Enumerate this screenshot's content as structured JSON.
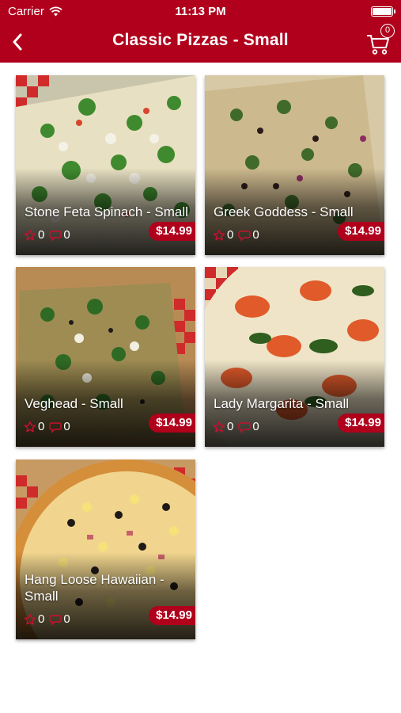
{
  "status_bar": {
    "carrier": "Carrier",
    "time": "11:13 PM",
    "icons": [
      "wifi-icon",
      "battery-icon"
    ]
  },
  "nav": {
    "back_icon": "chevron-left-icon",
    "title": "Classic Pizzas - Small",
    "cart_icon": "cart-icon",
    "cart_count": "0"
  },
  "colors": {
    "brand_red": "#b0001c",
    "background": "#ffffff",
    "text_on_brand": "#ffffff"
  },
  "products": [
    {
      "name": "Stone Feta Spinach - Small",
      "rating": "0",
      "comments": "0",
      "price": "$14.99",
      "image": "pizza-spinach-feta"
    },
    {
      "name": "Greek Goddess - Small",
      "rating": "0",
      "comments": "0",
      "price": "$14.99",
      "image": "pizza-greek"
    },
    {
      "name": "Veghead - Small",
      "rating": "0",
      "comments": "0",
      "price": "$14.99",
      "image": "pizza-veggie"
    },
    {
      "name": "Lady Margarita - Small",
      "rating": "0",
      "comments": "0",
      "price": "$14.99",
      "image": "pizza-margarita"
    },
    {
      "name": "Hang Loose Hawaiian - Small",
      "rating": "0",
      "comments": "0",
      "price": "$14.99",
      "image": "pizza-hawaiian"
    }
  ],
  "card_icons": {
    "rating": "star-outline-icon",
    "comments": "comment-bubble-icon"
  }
}
